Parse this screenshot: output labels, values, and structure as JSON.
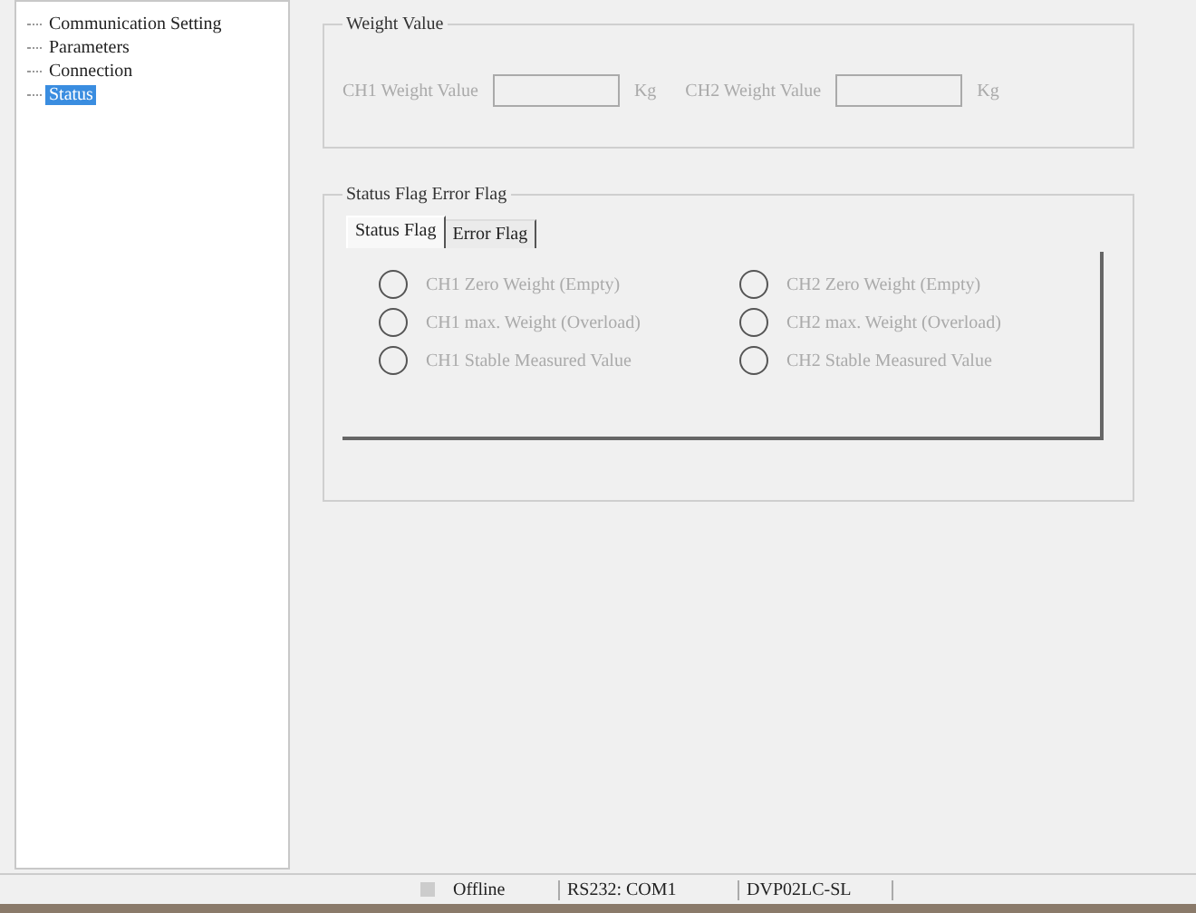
{
  "tree": {
    "items": [
      {
        "label": "Communication Setting",
        "selected": false
      },
      {
        "label": "Parameters",
        "selected": false
      },
      {
        "label": "Connection",
        "selected": false
      },
      {
        "label": "Status",
        "selected": true
      }
    ]
  },
  "weight_group": {
    "title": "Weight Value",
    "fields": [
      {
        "label": "CH1 Weight Value",
        "unit": "Kg",
        "disabled": true
      },
      {
        "label": "CH2 Weight Value",
        "unit": "Kg",
        "disabled": true
      }
    ]
  },
  "flag_group": {
    "title": "Status Flag Error Flag",
    "tabs": [
      {
        "label": "Status Flag",
        "selected": true
      },
      {
        "label": "Error Flag",
        "selected": false
      }
    ],
    "flags": [
      {
        "label": "CH1 Zero Weight (Empty)",
        "selected": false,
        "disabled": true
      },
      {
        "label": "CH2 Zero Weight (Empty)",
        "selected": false,
        "disabled": true
      },
      {
        "label": "CH1 max. Weight (Overload)",
        "selected": false,
        "disabled": true
      },
      {
        "label": "CH2 max. Weight (Overload)",
        "selected": false,
        "disabled": true
      },
      {
        "label": "CH1 Stable Measured Value",
        "selected": false,
        "disabled": true
      },
      {
        "label": "CH2 Stable Measured Value",
        "selected": false,
        "disabled": true
      }
    ]
  },
  "status_bar": {
    "connection": "Offline",
    "port": "RS232: COM1",
    "device": "DVP02LC-SL"
  }
}
